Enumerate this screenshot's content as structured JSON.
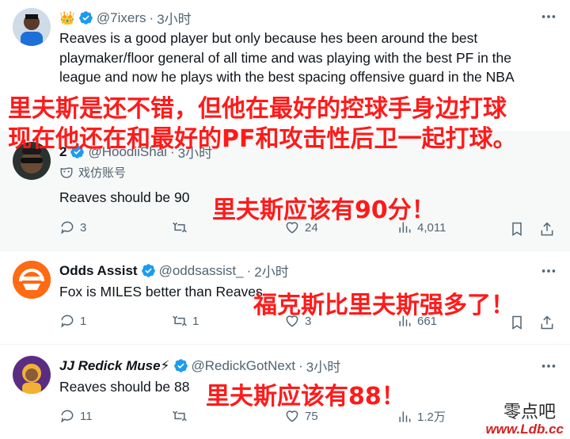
{
  "tweets": [
    {
      "badge_emoji": "👑",
      "handle": "@7ixers",
      "dot": "·",
      "time": "3小时",
      "text": "Reaves is a good player but only because hes been around the best playmaker/floor general of all time and was playing with the best PF in the league and now he plays with the best spacing offensive guard in the NBA"
    },
    {
      "name": "2",
      "handle": "@HoodiiShai",
      "dot": "·",
      "time": "3小时",
      "label": "戏仿账号",
      "text": "Reaves should be 90",
      "replies": "3",
      "reposts": "",
      "likes": "24",
      "views": "4,011"
    },
    {
      "name": "Odds Assist",
      "handle": "@oddsassist_",
      "dot": "·",
      "time": "2小时",
      "text": "Fox is MILES better than Reaves",
      "replies": "1",
      "reposts": "1",
      "likes": "3",
      "views": "661"
    },
    {
      "name": "JJ Redick Muse⚡",
      "handle": "@RedickGotNext",
      "dot": "·",
      "time": "3小时",
      "text": "Reaves should be 88",
      "replies": "11",
      "reposts": "",
      "likes": "75",
      "views": "1.2万"
    }
  ],
  "overlays": {
    "o1_line1": "里夫斯是还不错，但他在最好的控球手身边打球",
    "o1_line2": "现在他还在和最好的PF和攻击性后卫一起打球。",
    "o2": "里夫斯应该有90分！",
    "o3": "福克斯比里夫斯强多了！",
    "o4": "里夫斯应该有88！"
  },
  "watermark": {
    "top": "零点吧",
    "bottom": "www.Ldb.cc"
  },
  "colors": {
    "verified": "#1d9bf0",
    "overlay_red": "#ff1a1a",
    "meta_gray": "#536471"
  }
}
